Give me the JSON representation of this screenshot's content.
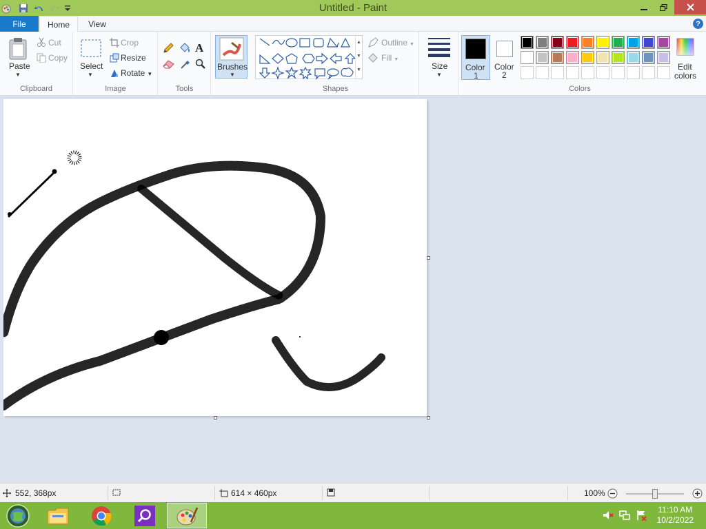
{
  "window": {
    "title": "Untitled - Paint"
  },
  "ribbon": {
    "tabs": {
      "file": "File",
      "home": "Home",
      "view": "View"
    },
    "help": "?",
    "clipboard": {
      "paste": "Paste",
      "cut": "Cut",
      "copy": "Copy",
      "label": "Clipboard"
    },
    "image": {
      "select": "Select",
      "crop": "Crop",
      "resize": "Resize",
      "rotate": "Rotate",
      "label": "Image"
    },
    "tools": {
      "label": "Tools",
      "text_tool": "A"
    },
    "brushes": {
      "label": "Brushes"
    },
    "shapes": {
      "outline": "Outline",
      "fill": "Fill",
      "label": "Shapes"
    },
    "size": {
      "label": "Size"
    },
    "color1": {
      "label_a": "Color",
      "label_b": "1",
      "color": "#000000"
    },
    "color2": {
      "label_a": "Color",
      "label_b": "2",
      "color": "#ffffff"
    },
    "colors": {
      "label": "Colors",
      "palette_row1": [
        "#000000",
        "#7f7f7f",
        "#880015",
        "#ed1c24",
        "#ff7f27",
        "#fff200",
        "#22b14c",
        "#00a2e8",
        "#3f48cc",
        "#a349a4"
      ],
      "palette_row2": [
        "#ffffff",
        "#c3c3c3",
        "#b97a57",
        "#ffaec9",
        "#ffc90e",
        "#efe4b0",
        "#b5e61d",
        "#99d9ea",
        "#7092be",
        "#c8bfe7"
      ],
      "edit_a": "Edit",
      "edit_b": "colors"
    }
  },
  "statusbar": {
    "cursor_pos": "552, 368px",
    "canvas_size": "614 × 460px",
    "zoom": "100%"
  },
  "taskbar": {
    "time": "11:10 AM",
    "date": "10/2/2022"
  },
  "colors": {
    "titlebar": "#a1c95a",
    "file_tab": "#1979ca",
    "taskbar": "#7fb83d",
    "workspace": "#dbe3ef"
  }
}
